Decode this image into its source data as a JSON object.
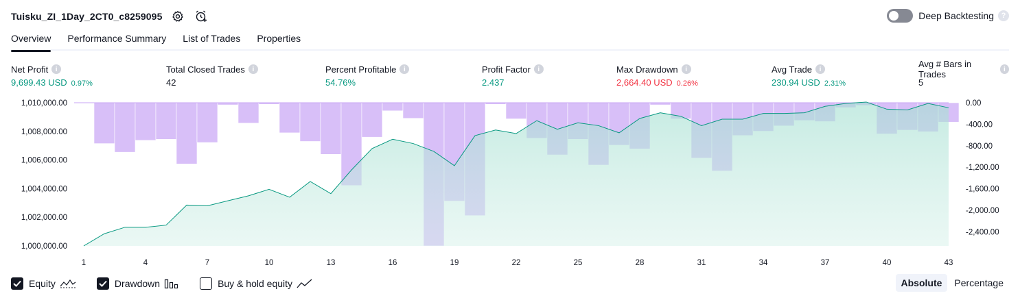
{
  "header": {
    "title": "Tuisku_ZI_1Day_2CT0_c8259095",
    "settings_icon": "gear-icon",
    "alert_icon": "add-alert-icon",
    "deep_backtesting_label": "Deep Backtesting",
    "deep_backtesting_enabled": false
  },
  "tabs": [
    {
      "label": "Overview",
      "active": true
    },
    {
      "label": "Performance Summary",
      "active": false
    },
    {
      "label": "List of Trades",
      "active": false
    },
    {
      "label": "Properties",
      "active": false
    }
  ],
  "metrics": [
    {
      "label": "Net Profit",
      "value": "9,699.43 USD",
      "pct": "0.97%",
      "color": "#089981"
    },
    {
      "label": "Total Closed Trades",
      "value": "42",
      "pct": "",
      "color": "#131722"
    },
    {
      "label": "Percent Profitable",
      "value": "54.76%",
      "pct": "",
      "color": "#089981"
    },
    {
      "label": "Profit Factor",
      "value": "2.437",
      "pct": "",
      "color": "#089981"
    },
    {
      "label": "Max Drawdown",
      "value": "2,664.40 USD",
      "pct": "0.26%",
      "color": "#f23645"
    },
    {
      "label": "Avg Trade",
      "value": "230.94 USD",
      "pct": "2.31%",
      "color": "#089981"
    },
    {
      "label": "Avg # Bars in Trades",
      "value": "5",
      "pct": "",
      "color": "#131722"
    }
  ],
  "chart_data": {
    "type": "line",
    "x": [
      1,
      2,
      3,
      4,
      5,
      6,
      7,
      8,
      9,
      10,
      11,
      12,
      13,
      14,
      15,
      16,
      17,
      18,
      19,
      20,
      21,
      22,
      23,
      24,
      25,
      26,
      27,
      28,
      29,
      30,
      31,
      32,
      33,
      34,
      35,
      36,
      37,
      38,
      39,
      40,
      41,
      42,
      43
    ],
    "x_tick_labels": [
      "1",
      "4",
      "7",
      "10",
      "13",
      "16",
      "19",
      "22",
      "25",
      "28",
      "31",
      "34",
      "37",
      "40",
      "43"
    ],
    "y_left_ticks": [
      "1,010,000.00",
      "1,008,000.00",
      "1,006,000.00",
      "1,004,000.00",
      "1,002,000.00",
      "1,000,000.00"
    ],
    "y_left_range": [
      1000000,
      1010000
    ],
    "y_right_ticks": [
      "0.00",
      "-400.00",
      "-800.00",
      "-1,200.00",
      "-1,600.00",
      "-2,000.00",
      "-2,400.00"
    ],
    "y_right_range": [
      -2664.4,
      0
    ],
    "series": [
      {
        "name": "Equity",
        "axis": "left",
        "color": "#089981",
        "values": [
          1000000,
          1000850,
          1001300,
          1001300,
          1001450,
          1002850,
          1002800,
          1003150,
          1003500,
          1003950,
          1003400,
          1004500,
          1003650,
          1005300,
          1006800,
          1007450,
          1007150,
          1006600,
          1005600,
          1007700,
          1008100,
          1007850,
          1008750,
          1008150,
          1008600,
          1008400,
          1007900,
          1008900,
          1009300,
          1009050,
          1008400,
          1008850,
          1008850,
          1009250,
          1009250,
          1009300,
          1009750,
          1009950,
          1010050,
          1009550,
          1009500,
          1009950,
          1009650
        ]
      },
      {
        "name": "Drawdown",
        "axis": "right",
        "color": "#d3b3f7",
        "values": [
          0,
          -760,
          -920,
          -700,
          -680,
          -1140,
          -740,
          -40,
          -380,
          -30,
          -560,
          -720,
          -960,
          -1540,
          -640,
          -150,
          -290,
          -2664.4,
          -1830,
          -2100,
          -30,
          -300,
          -660,
          -970,
          -680,
          -1160,
          -790,
          -860,
          -40,
          -300,
          -1030,
          -1270,
          -610,
          -530,
          -430,
          -330,
          -350,
          -90,
          -50,
          -580,
          -510,
          -540,
          -360
        ]
      }
    ],
    "grid": false
  },
  "legend": [
    {
      "label": "Equity",
      "checked": true,
      "icon": "equity-line-icon"
    },
    {
      "label": "Drawdown",
      "checked": true,
      "icon": "drawdown-bars-icon"
    },
    {
      "label": "Buy & hold equity",
      "checked": false,
      "icon": "buy-hold-line-icon"
    }
  ],
  "view_mode": {
    "options": [
      "Absolute",
      "Percentage"
    ],
    "selected": "Absolute"
  }
}
